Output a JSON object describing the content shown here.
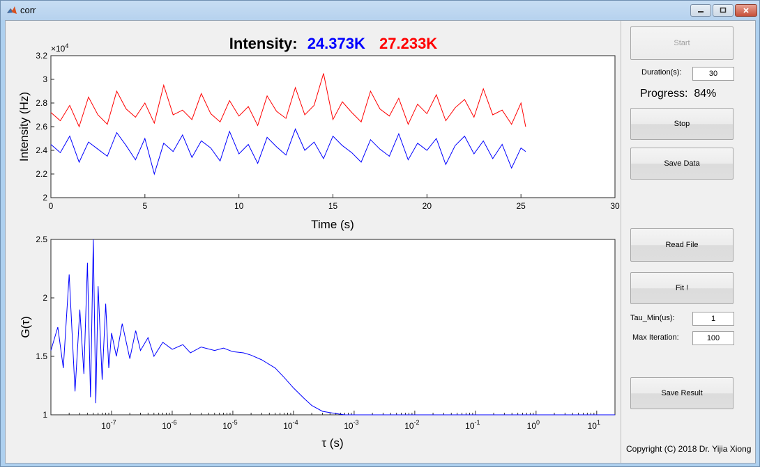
{
  "window": {
    "title": "corr"
  },
  "header": {
    "label": "Intensity:",
    "blue_value": "24.373K",
    "red_value": "27.233K",
    "blue_color": "#0000ff",
    "red_color": "#ff0000"
  },
  "controls": {
    "start_label": "Start",
    "duration_label": "Duration(s):",
    "duration_value": "30",
    "progress_label": "Progress:",
    "progress_value": "84%",
    "stop_label": "Stop",
    "save_data_label": "Save Data",
    "read_file_label": "Read File",
    "fit_label": "Fit !",
    "tau_min_label": "Tau_Min(us):",
    "tau_min_value": "1",
    "max_iter_label": "Max Iteration:",
    "max_iter_value": "100",
    "save_result_label": "Save Result",
    "copyright": "Copyright (C) 2018 Dr. Yijia Xiong"
  },
  "chart_data": [
    {
      "type": "line",
      "xlabel": "Time (s)",
      "ylabel": "Intensity (Hz)",
      "xlim": [
        0,
        30
      ],
      "ylim": [
        2.0,
        3.2
      ],
      "exponent_label": "×10",
      "exponent": "4",
      "xticks": [
        "0",
        "5",
        "10",
        "15",
        "20",
        "25",
        "30"
      ],
      "yticks": [
        "2",
        "2.2",
        "2.4",
        "2.6",
        "2.8",
        "3",
        "3.2"
      ],
      "series": [
        {
          "color": "#ff0000",
          "x": [
            0.0,
            0.5,
            1.0,
            1.5,
            2.0,
            2.5,
            3.0,
            3.5,
            4.0,
            4.5,
            5.0,
            5.5,
            6.0,
            6.5,
            7.0,
            7.5,
            8.0,
            8.5,
            9.0,
            9.5,
            10.0,
            10.5,
            11.0,
            11.5,
            12.0,
            12.5,
            13.0,
            13.5,
            14.0,
            14.5,
            15.0,
            15.5,
            16.0,
            16.5,
            17.0,
            17.5,
            18.0,
            18.5,
            19.0,
            19.5,
            20.0,
            20.5,
            21.0,
            21.5,
            22.0,
            22.5,
            23.0,
            23.5,
            24.0,
            24.5,
            25.0,
            25.25
          ],
          "y": [
            2.72,
            2.65,
            2.78,
            2.6,
            2.85,
            2.7,
            2.62,
            2.9,
            2.75,
            2.68,
            2.8,
            2.63,
            2.95,
            2.7,
            2.74,
            2.66,
            2.88,
            2.71,
            2.64,
            2.82,
            2.69,
            2.77,
            2.61,
            2.86,
            2.73,
            2.67,
            2.93,
            2.7,
            2.78,
            3.05,
            2.66,
            2.81,
            2.72,
            2.64,
            2.9,
            2.75,
            2.69,
            2.84,
            2.62,
            2.79,
            2.71,
            2.87,
            2.65,
            2.76,
            2.83,
            2.68,
            2.92,
            2.7,
            2.74,
            2.62,
            2.8,
            2.6
          ]
        },
        {
          "color": "#0000ff",
          "x": [
            0.0,
            0.5,
            1.0,
            1.5,
            2.0,
            2.5,
            3.0,
            3.5,
            4.0,
            4.5,
            5.0,
            5.5,
            6.0,
            6.5,
            7.0,
            7.5,
            8.0,
            8.5,
            9.0,
            9.5,
            10.0,
            10.5,
            11.0,
            11.5,
            12.0,
            12.5,
            13.0,
            13.5,
            14.0,
            14.5,
            15.0,
            15.5,
            16.0,
            16.5,
            17.0,
            17.5,
            18.0,
            18.5,
            19.0,
            19.5,
            20.0,
            20.5,
            21.0,
            21.5,
            22.0,
            22.5,
            23.0,
            23.5,
            24.0,
            24.5,
            25.0,
            25.25
          ],
          "y": [
            2.45,
            2.38,
            2.52,
            2.3,
            2.47,
            2.41,
            2.35,
            2.55,
            2.44,
            2.32,
            2.5,
            2.2,
            2.46,
            2.39,
            2.53,
            2.34,
            2.48,
            2.42,
            2.31,
            2.56,
            2.37,
            2.45,
            2.29,
            2.51,
            2.43,
            2.36,
            2.58,
            2.4,
            2.47,
            2.33,
            2.52,
            2.44,
            2.38,
            2.3,
            2.49,
            2.41,
            2.35,
            2.54,
            2.32,
            2.46,
            2.4,
            2.5,
            2.28,
            2.44,
            2.52,
            2.37,
            2.48,
            2.33,
            2.45,
            2.25,
            2.42,
            2.39
          ]
        }
      ]
    },
    {
      "type": "line",
      "xlabel": "τ (s)",
      "ylabel": "G(τ)",
      "xscale": "log",
      "xlim": [
        1e-08,
        20
      ],
      "ylim": [
        1,
        2.5
      ],
      "xticks": [
        {
          "v": 1e-07,
          "base": "10",
          "exp": "-7"
        },
        {
          "v": 1e-06,
          "base": "10",
          "exp": "-6"
        },
        {
          "v": 1e-05,
          "base": "10",
          "exp": "-5"
        },
        {
          "v": 0.0001,
          "base": "10",
          "exp": "-4"
        },
        {
          "v": 0.001,
          "base": "10",
          "exp": "-3"
        },
        {
          "v": 0.01,
          "base": "10",
          "exp": "-2"
        },
        {
          "v": 0.1,
          "base": "10",
          "exp": "-1"
        },
        {
          "v": 1,
          "base": "10",
          "exp": "0"
        },
        {
          "v": 10,
          "base": "10",
          "exp": "1"
        }
      ],
      "yticks": [
        "1",
        "1.5",
        "2",
        "2.5"
      ],
      "series": [
        {
          "color": "#0000ff",
          "x": [
            1e-08,
            1.3e-08,
            1.6e-08,
            2e-08,
            2.5e-08,
            3e-08,
            3.5e-08,
            4e-08,
            4.5e-08,
            5e-08,
            5.5e-08,
            6e-08,
            7e-08,
            8e-08,
            9e-08,
            1e-07,
            1.2e-07,
            1.5e-07,
            2e-07,
            2.5e-07,
            3e-07,
            4e-07,
            5e-07,
            7e-07,
            1e-06,
            1.5e-06,
            2e-06,
            3e-06,
            5e-06,
            7e-06,
            1e-05,
            1.5e-05,
            2e-05,
            3e-05,
            5e-05,
            7e-05,
            0.0001,
            0.00015,
            0.0002,
            0.0003,
            0.0005,
            0.0007,
            0.001,
            0.01,
            0.1,
            1,
            10,
            20
          ],
          "y": [
            1.55,
            1.75,
            1.4,
            2.2,
            1.2,
            1.9,
            1.35,
            2.3,
            1.15,
            2.5,
            1.1,
            2.1,
            1.3,
            1.95,
            1.4,
            1.7,
            1.5,
            1.78,
            1.48,
            1.72,
            1.55,
            1.66,
            1.5,
            1.62,
            1.56,
            1.6,
            1.53,
            1.58,
            1.55,
            1.57,
            1.54,
            1.53,
            1.51,
            1.47,
            1.4,
            1.32,
            1.23,
            1.14,
            1.08,
            1.03,
            1.01,
            1.0,
            1.0,
            1.0,
            1.0,
            1.0,
            1.0,
            1.0
          ]
        }
      ]
    }
  ]
}
